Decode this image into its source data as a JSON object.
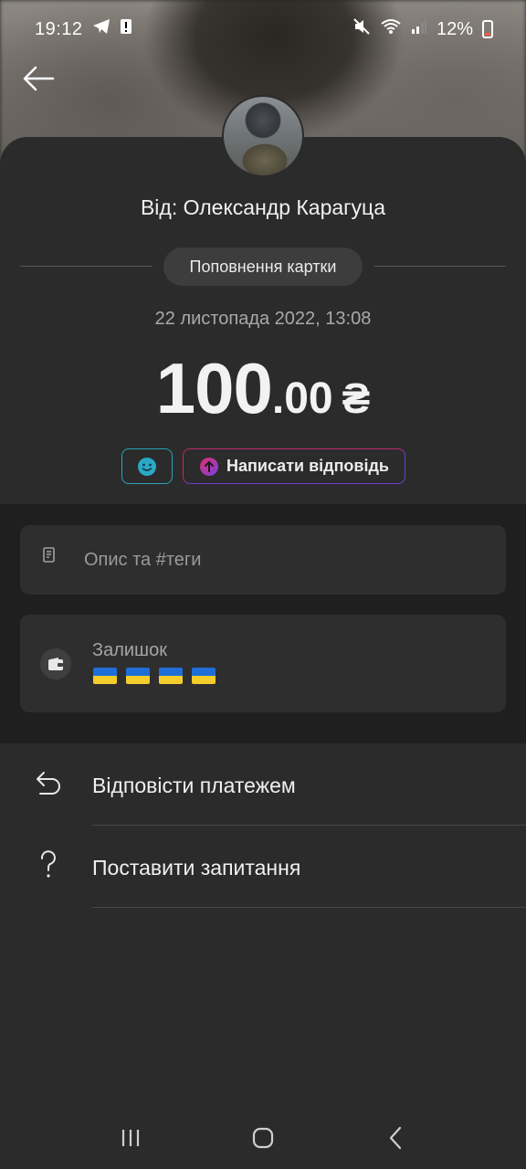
{
  "status_bar": {
    "time": "19:12",
    "battery_percent": "12%",
    "icons": [
      "telegram-icon",
      "alert-icon",
      "mute-icon",
      "wifi-icon",
      "signal-icon",
      "battery-icon"
    ]
  },
  "transaction": {
    "sender": "Від: Олександр Карагуца",
    "type_label": "Поповнення картки",
    "datetime": "22 листопада 2022, 13:08",
    "amount_int": "100",
    "amount_frac": ".00",
    "currency": "₴"
  },
  "actions": {
    "reply_label": "Написати відповідь",
    "emoji_icon": "smile-icon"
  },
  "description": {
    "placeholder": "Опис та #теги"
  },
  "balance": {
    "label": "Залишок",
    "flags_count": 4
  },
  "menu": [
    {
      "label": "Відповісти платежем",
      "icon": "reply-arrow-icon"
    },
    {
      "label": "Поставити запитання",
      "icon": "question-icon"
    }
  ],
  "colors": {
    "accent_teal": "#2aa3b8",
    "accent_pink": "#c2296e",
    "accent_purple": "#6a3fd1",
    "flag_blue": "#1f6fd6",
    "flag_yellow": "#f4cd2a"
  }
}
